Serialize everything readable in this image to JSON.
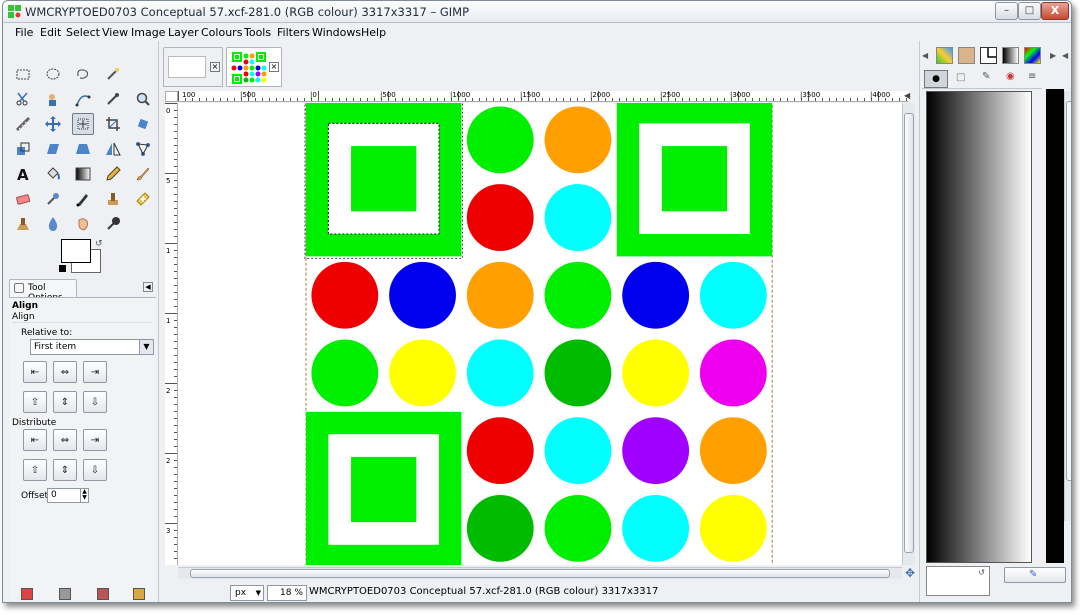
{
  "window": {
    "title": "WMCRYPTOED0703 Conceptual 57.xcf-281.0 (RGB colour) 3317x3317 – GIMP",
    "minimize_label": "–",
    "maximize_label": "□",
    "close_label": "X"
  },
  "menu": [
    "File",
    "Edit",
    "Select",
    "View",
    "Image",
    "Layer",
    "Colours",
    "Tools",
    "Filters",
    "Windows",
    "Help"
  ],
  "tools": [
    "rect-select",
    "ellipse-select",
    "free-select",
    "fuzzy-select",
    "",
    "scissors-select",
    "foreground-select",
    "paths",
    "color-picker",
    "zoom",
    "measure",
    "move",
    "align",
    "crop",
    "rotate",
    "scale",
    "shear",
    "perspective",
    "flip",
    "cage",
    "text",
    "bucket-fill",
    "blend",
    "pencil",
    "paintbrush",
    "eraser",
    "airbrush",
    "ink",
    "clone",
    "heal",
    "perspective-clone",
    "blur",
    "smudge",
    "dodge-burn",
    ""
  ],
  "tool_options": {
    "tab_label": "Tool Options",
    "title": "Align",
    "subtitle": "Align",
    "relative_label": "Relative to:",
    "relative_value": "First item",
    "distribute_label": "Distribute",
    "offset_label": "Offset:",
    "offset_value": "0"
  },
  "rulers": {
    "h_labels": [
      "100",
      "|500",
      "|0",
      "|500",
      "|1000",
      "|1500",
      "|2000",
      "|2500",
      "|3000",
      "|3500",
      "|4000"
    ],
    "v_labels": [
      "0",
      "5",
      "1",
      "1",
      "2",
      "2",
      "3"
    ]
  },
  "canvas": {
    "colors": {
      "green": "#00ee00",
      "dark_green": "#00bb00",
      "red": "#ee0000",
      "orange": "#ff9f00",
      "cyan": "#00ffff",
      "blue": "#0000ee",
      "yellow": "#ffff00",
      "magenta": "#ee00ee",
      "purple": "#9f00ff",
      "white": "#ffffff"
    },
    "circle_grid": [
      [
        "qr",
        "qr",
        "green",
        "orange",
        "qr",
        "qr"
      ],
      [
        "qr",
        "qr",
        "red",
        "cyan",
        "qr",
        "qr"
      ],
      [
        "red",
        "blue",
        "orange",
        "green",
        "blue",
        "cyan"
      ],
      [
        "green",
        "yellow",
        "cyan",
        "dark_green",
        "yellow",
        "magenta"
      ],
      [
        "qr",
        "qr",
        "red",
        "cyan",
        "purple",
        "orange"
      ],
      [
        "qr",
        "qr",
        "dark_green",
        "green",
        "cyan",
        "yellow"
      ]
    ]
  },
  "status": {
    "unit": "px",
    "zoom": "18 %",
    "info": "WMCRYPTOED0703 Conceptual 57.xcf-281.0 (RGB colour) 3317x3317"
  }
}
